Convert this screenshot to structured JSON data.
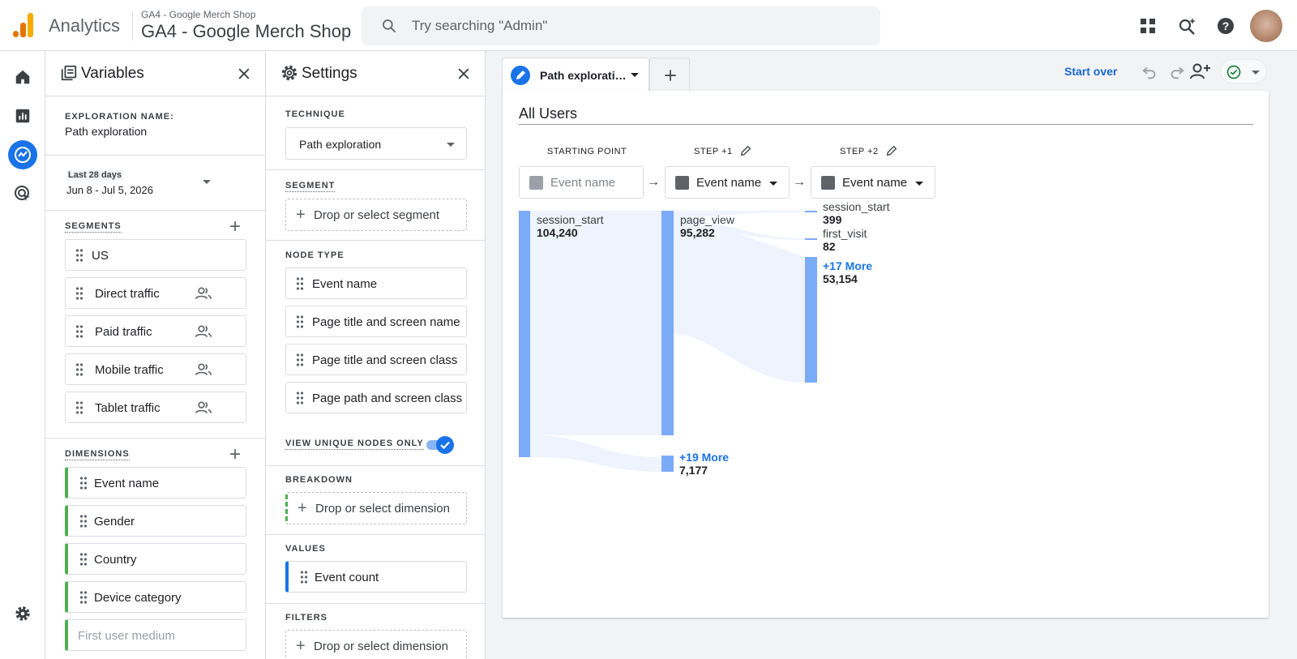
{
  "app": {
    "name": "Analytics",
    "property_small": "GA4 - Google Merch Shop",
    "property_big": "GA4 - Google Merch Shop"
  },
  "search": {
    "placeholder": "Try searching \"Admin\""
  },
  "colors": {
    "accent": "#1a73e8",
    "flow_bar": "#7baaf7",
    "flow_band": "#eef3fd",
    "dimension_marker": "#4caf50",
    "logo_orange": "#f9ab00",
    "logo_dark_orange": "#e37400"
  },
  "variables": {
    "title": "Variables",
    "exploration_name_label": "EXPLORATION NAME:",
    "exploration_name": "Path exploration",
    "date_range_label": "Last 28 days",
    "date_range": "Jun 8 - Jul 5, 2026",
    "segments_label": "SEGMENTS",
    "segments": [
      {
        "label": "US",
        "people_icon": false
      },
      {
        "label": "Direct traffic",
        "people_icon": true
      },
      {
        "label": "Paid traffic",
        "people_icon": true
      },
      {
        "label": "Mobile traffic",
        "people_icon": true
      },
      {
        "label": "Tablet traffic",
        "people_icon": true
      }
    ],
    "dimensions_label": "DIMENSIONS",
    "dimensions": [
      "Event name",
      "Gender",
      "Country",
      "Device category"
    ],
    "dimension_placeholder": "First user medium"
  },
  "settings": {
    "title": "Settings",
    "technique_label": "TECHNIQUE",
    "technique_value": "Path exploration",
    "segment_label": "SEGMENT",
    "segment_drop": "Drop or select segment",
    "node_type_label": "NODE TYPE",
    "node_types": [
      "Event name",
      "Page title and screen name",
      "Page title and screen class",
      "Page path and screen class"
    ],
    "unique_nodes_label": "VIEW UNIQUE NODES ONLY",
    "unique_nodes_on": true,
    "breakdown_label": "BREAKDOWN",
    "breakdown_drop": "Drop or select dimension",
    "values_label": "VALUES",
    "values_value": "Event count",
    "filters_label": "FILTERS",
    "filters_drop": "Drop or select dimension"
  },
  "tabs": {
    "active": "Path explorati…"
  },
  "toolbar": {
    "start_over": "Start over"
  },
  "canvas": {
    "segment_title": "All Users",
    "steps": [
      {
        "label": "STARTING POINT",
        "value": "Event name",
        "placeholder": true
      },
      {
        "label": "STEP +1",
        "value": "Event name",
        "placeholder": false
      },
      {
        "label": "STEP +2",
        "value": "Event name",
        "placeholder": false
      }
    ],
    "nodes": {
      "start": {
        "name": "session_start",
        "value": "104,240"
      },
      "step1": {
        "name": "page_view",
        "value": "95,282"
      },
      "step1_more": {
        "name": "+19 More",
        "value": "7,177"
      },
      "step2_a": {
        "name": "session_start",
        "value": "399"
      },
      "step2_b": {
        "name": "first_visit",
        "value": "82"
      },
      "step2_more": {
        "name": "+17 More",
        "value": "53,154"
      }
    }
  }
}
